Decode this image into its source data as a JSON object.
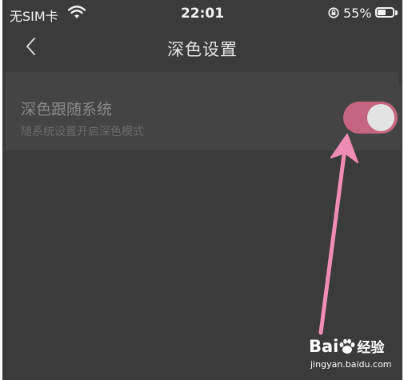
{
  "status_bar": {
    "carrier": "无SIM卡",
    "time": "22:01",
    "battery_percent": "55%",
    "battery_level": 0.55
  },
  "nav": {
    "title": "深色设置",
    "back_icon": "chevron-left-icon"
  },
  "setting": {
    "title": "深色跟随系统",
    "subtitle": "随系统设置开启深色模式",
    "toggle_on": true
  },
  "colors": {
    "background": "#3b3b3b",
    "card": "#444444",
    "toggle_on": "#c5657f",
    "annotation_arrow": "#f08db4"
  },
  "watermark": {
    "brand": "Bai",
    "brand_tail": "经验",
    "url": "jingyan.baidu.com"
  }
}
